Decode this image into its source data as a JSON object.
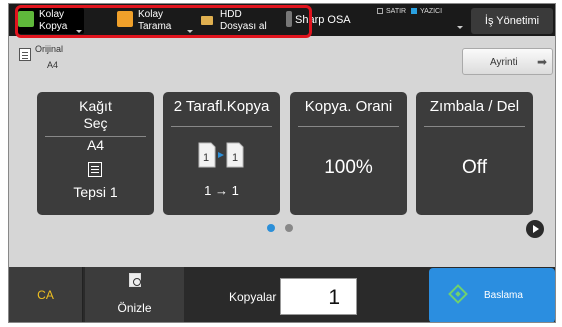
{
  "topbar": {
    "shortcuts": [
      {
        "line1": "Kolay",
        "line2": "Kopya",
        "icon": "copy-icon"
      },
      {
        "line1": "Kolay",
        "line2": "Tarama",
        "icon": "scan-icon"
      },
      {
        "line1": "HDD",
        "line2": "Dosyası al",
        "icon": "folder-icon"
      },
      {
        "line1": "Sharp OSA",
        "icon": "osa-icon"
      }
    ],
    "indicators": {
      "line": "SATIR",
      "printer": "YAZICI"
    },
    "jobs_label": "İş Yönetimi",
    "highlight_color": "#e1141e"
  },
  "original": {
    "label": "Orijinal",
    "size": "A4"
  },
  "detail_label": "Ayrinti",
  "functions": {
    "paper": {
      "title_line1": "Kağıt",
      "title_line2": "Seç",
      "size": "A4",
      "tray": "Tepsi 1"
    },
    "duplex": {
      "title": "2 Tarafl.Kopya",
      "mode": "1 → 1",
      "page_left": "1",
      "page_right": "1"
    },
    "ratio": {
      "title": "Kopya. Orani",
      "value": "100%"
    },
    "staple": {
      "title": "Zımbala / Del",
      "value": "Off"
    }
  },
  "pager": {
    "pages": 2,
    "current": 1
  },
  "bottom": {
    "ca_label": "CA",
    "preview_label": "Önizle",
    "copies_label": "Kopyalar",
    "copies_value": "1",
    "start_label": "Baslama"
  },
  "colors": {
    "accent": "#2b8ee0",
    "ca": "#f0c020",
    "start_icon": "#6fd16f"
  }
}
